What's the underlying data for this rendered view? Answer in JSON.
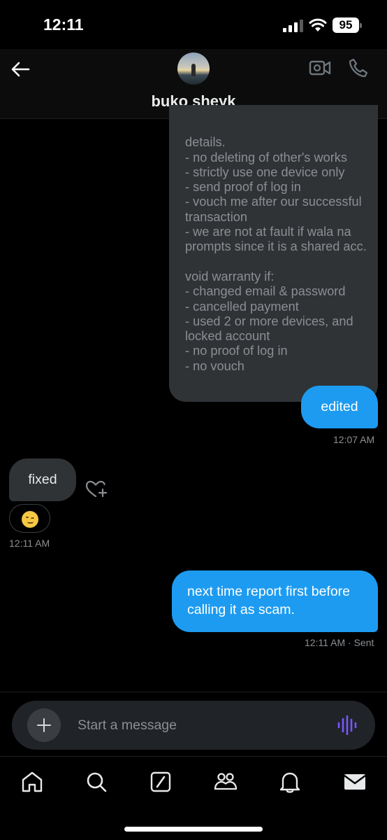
{
  "status_bar": {
    "time": "12:11",
    "battery": "95"
  },
  "header": {
    "name": "buko sheyk"
  },
  "messages": {
    "received_partial_text": "details.\n- no deleting of other's works\n- strictly use one device only\n- send proof of log in\n- vouch me after our successful transaction\n- we are not at fault if wala na prompts since it is a shared acc.\n\nvoid warranty if:\n- changed email & password\n- cancelled payment\n- used 2 or more devices, and locked account\n- no proof of log in\n- no vouch",
    "sent_1": "edited",
    "sent_1_time": "12:07 AM",
    "received_1": "fixed",
    "received_1_time": "12:11 AM",
    "received_1_reaction": "face-with-rolling-eyes-emoji",
    "sent_2": "next time report first before calling it as scam.",
    "sent_2_time": "12:11 AM",
    "sent_2_status": "· Sent"
  },
  "composer": {
    "placeholder": "Start a message"
  },
  "icons": {
    "back": "back-arrow-icon",
    "video": "video-call-icon",
    "phone": "phone-call-icon",
    "add": "plus-icon",
    "voice": "voice-wave-icon",
    "react": "heart-plus-icon",
    "nav": [
      "home-icon",
      "search-icon",
      "grok-icon",
      "communities-icon",
      "notifications-icon",
      "messages-icon"
    ]
  },
  "colors": {
    "accent": "#1d9bf0",
    "bubble_in": "#2f3336",
    "voice": "#7856ff"
  }
}
